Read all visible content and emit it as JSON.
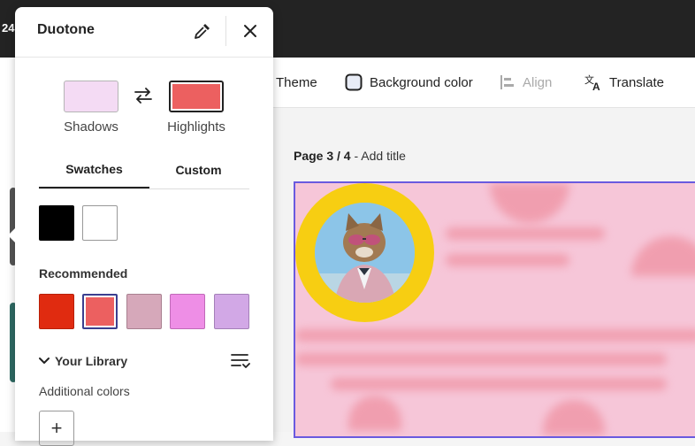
{
  "topbar": {
    "fragment": "24"
  },
  "toolbar": {
    "theme": "Theme",
    "background_color": "Background color",
    "align": "Align",
    "translate": "Translate"
  },
  "canvas": {
    "page_num": "Page 3 / 4",
    "page_sep": " - ",
    "add_title": "Add title"
  },
  "panel": {
    "title": "Duotone",
    "shadows_label": "Shadows",
    "highlights_label": "Highlights",
    "shadows_color": "#f4dbf4",
    "highlights_color": "#ec6060",
    "tabs": [
      "Swatches",
      "Custom"
    ],
    "active_tab": "Swatches",
    "basic_swatches": [
      "#000000",
      "#ffffff"
    ],
    "recommended_label": "Recommended",
    "recommended_swatches": [
      "#e02b10",
      "#ec6060",
      "#d6a8ba",
      "#ee8ee6",
      "#d2a8e6"
    ],
    "selected_recommended": 1,
    "library_label": "Your Library",
    "additional_label": "Additional colors",
    "add_symbol": "+"
  }
}
